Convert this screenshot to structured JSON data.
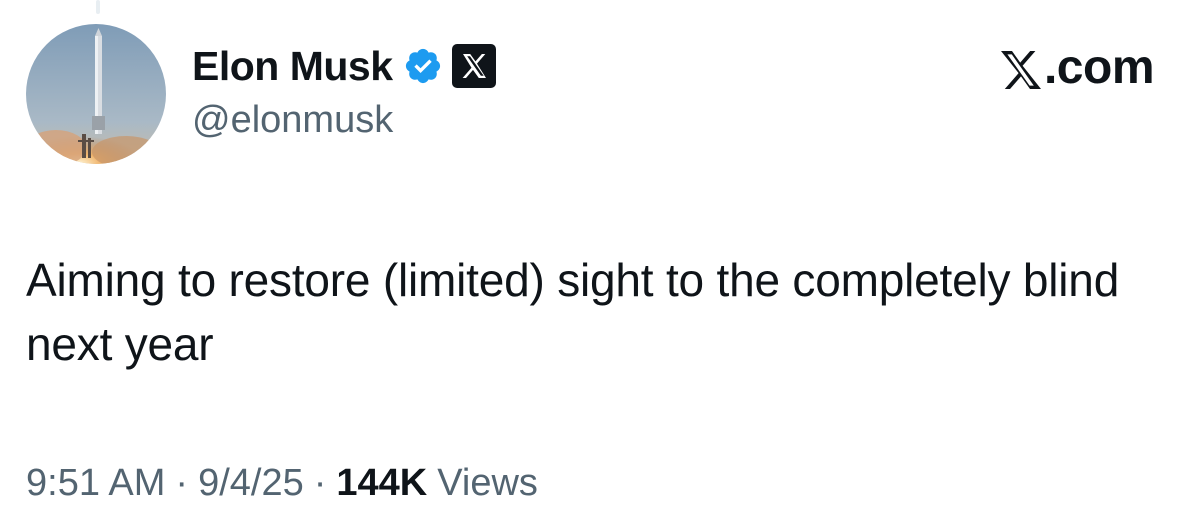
{
  "author": {
    "display_name": "Elon Musk",
    "handle": "@elonmusk",
    "avatar_icon": "rocket-launch-avatar",
    "verified_badge_color": "#1d9bf0",
    "affiliate_badge_icon": "x-logo-icon"
  },
  "brand": {
    "label": ".com",
    "icon": "x-logo-icon"
  },
  "tweet": {
    "text": "Aiming to restore (limited) sight to the completely blind next year"
  },
  "meta": {
    "time": "9:51 AM",
    "separator": "·",
    "date": "9/4/25",
    "views_count": "144K",
    "views_label": "Views"
  }
}
